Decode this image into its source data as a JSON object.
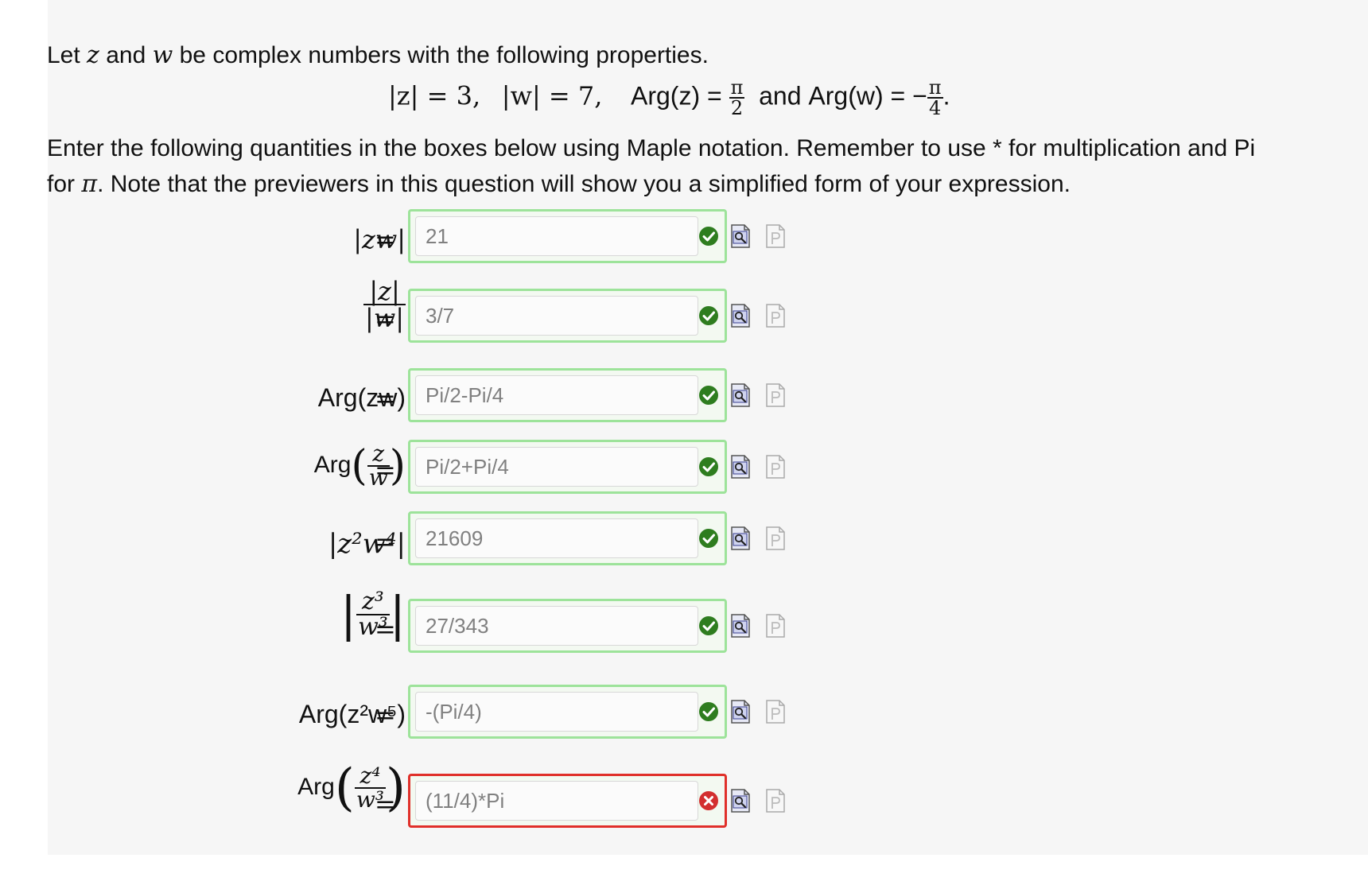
{
  "intro": {
    "line1_a": "Let ",
    "var_z": "z",
    "line1_b": " and ",
    "var_w": "w",
    "line1_c": " be complex numbers with the following properties.",
    "prop_absz": "|z| = 3,",
    "prop_absw": "|w| = 7,",
    "prop_argz_lbl": "Arg(z) =",
    "pi": "π",
    "two": "2",
    "and": "and",
    "prop_argw_lbl": "Arg(w) = −",
    "four": "4",
    "period": ".",
    "instr1": "Enter the following quantities in the boxes below using Maple notation.  Remember to use * for multiplication and Pi",
    "instr2_a": "for ",
    "instr2_b": ". Note that the previewers in this question will show you a simplified form of your expression."
  },
  "equals": "=",
  "questions": [
    {
      "lhs": "|zw|",
      "answer": "21",
      "status": "correct"
    },
    {
      "lhs_num": "|z|",
      "lhs_den": "|w|",
      "answer": "3/7",
      "status": "correct"
    },
    {
      "lhs": "Arg(zw)",
      "answer": "Pi/2-Pi/4",
      "status": "correct"
    },
    {
      "lhs_fn": "Arg",
      "lhs_num": "z",
      "lhs_den": "w",
      "answer": "Pi/2+Pi/4",
      "status": "correct"
    },
    {
      "lhs": "|z²w⁴|",
      "answer": "21609",
      "status": "correct"
    },
    {
      "lhs_num": "z³",
      "lhs_den": "w³",
      "answer": "27/343",
      "status": "correct"
    },
    {
      "lhs": "Arg(z²w⁵)",
      "answer": "-(Pi/4)",
      "status": "correct"
    },
    {
      "lhs_fn": "Arg",
      "lhs_num": "z⁴",
      "lhs_den": "w³",
      "answer": "(11/4)*Pi",
      "status": "incorrect"
    }
  ],
  "colors": {
    "correct_border": "#9de39a",
    "incorrect_border": "#e0302a",
    "correct_icon": "#2e7d1f",
    "incorrect_icon": "#d32f2f"
  },
  "icons": [
    "check-circle-icon",
    "x-circle-icon",
    "preview-icon",
    "maple-syntax-icon"
  ]
}
